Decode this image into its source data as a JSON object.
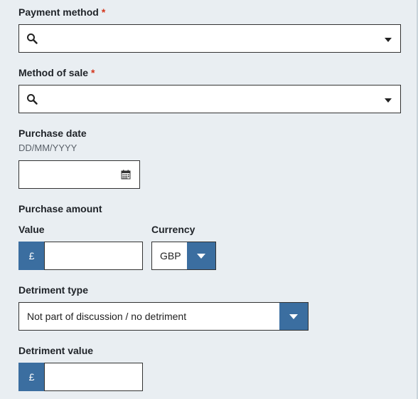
{
  "payment_method": {
    "label": "Payment method",
    "required_mark": "*",
    "value": ""
  },
  "method_of_sale": {
    "label": "Method of sale",
    "required_mark": "*",
    "value": ""
  },
  "purchase_date": {
    "label": "Purchase date",
    "hint": "DD/MM/YYYY",
    "value": ""
  },
  "purchase_amount": {
    "label": "Purchase amount",
    "value_label": "Value",
    "currency_symbol": "£",
    "value": "",
    "currency_label": "Currency",
    "currency_selected": "GBP"
  },
  "detriment_type": {
    "label": "Detriment type",
    "selected": "Not part of discussion / no detriment"
  },
  "detriment_value": {
    "label": "Detriment value",
    "currency_symbol": "£",
    "value": ""
  },
  "colors": {
    "accent": "#3b6ea0",
    "required": "#d4351c",
    "background": "#e9eef2"
  }
}
